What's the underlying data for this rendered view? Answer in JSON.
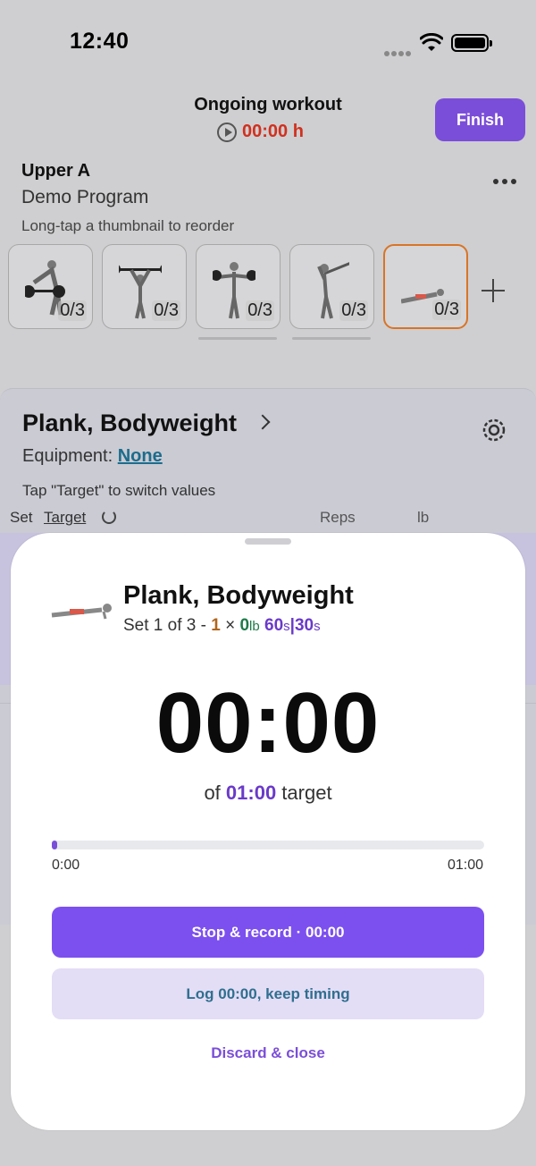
{
  "status_bar": {
    "time": "12:40"
  },
  "header": {
    "title": "Ongoing workout",
    "elapsed": "00:00 h",
    "finish_label": "Finish"
  },
  "workout": {
    "name": "Upper A",
    "program": "Demo Program",
    "hint": "Long-tap a thumbnail to reorder",
    "thumbnails": [
      {
        "count": "0/3",
        "icon": "bent-over-row-figure"
      },
      {
        "count": "0/3",
        "icon": "overhead-press-figure"
      },
      {
        "count": "0/3",
        "icon": "lateral-raise-figure"
      },
      {
        "count": "0/3",
        "icon": "landmine-press-figure"
      },
      {
        "count": "0/3",
        "icon": "plank-figure",
        "active": true
      }
    ]
  },
  "exercise": {
    "title": "Plank, Bodyweight",
    "equipment_label": "Equipment:",
    "equipment_value": "None",
    "tap_hint": "Tap \"Target\" to switch values",
    "columns": {
      "set": "Set",
      "target": "Target",
      "reps": "Reps",
      "lb": "lb"
    }
  },
  "timer_sheet": {
    "title": "Plank, Bodyweight",
    "set_text": "Set 1 of 3 - ",
    "reps": "1",
    "times": " × ",
    "weight": "0",
    "weight_unit": "lb",
    "time_a": "60",
    "time_a_unit": "s",
    "sep": "|",
    "time_b": "30",
    "time_b_unit": "s",
    "elapsed": "00:00",
    "target_prefix": "of ",
    "target_value": "01:00",
    "target_suffix": " target",
    "progress_start": "0:00",
    "progress_end": "01:00",
    "progress_fraction": 0.01,
    "stop_label": "Stop & record · 00:00",
    "log_label": "Log 00:00, keep timing",
    "discard_label": "Discard & close"
  },
  "colors": {
    "accent": "#7c50ef",
    "timer_red": "#d0301f",
    "active_border": "#d97426"
  }
}
